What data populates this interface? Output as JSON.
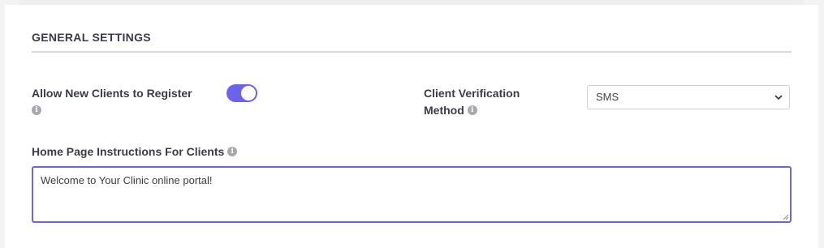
{
  "section": {
    "title": "GENERAL SETTINGS"
  },
  "allow_register": {
    "label": "Allow New Clients to Register",
    "enabled": true
  },
  "verification": {
    "label_line1": "Client Verification",
    "label_line2": "Method",
    "selected": "SMS"
  },
  "instructions": {
    "label": "Home Page Instructions For Clients",
    "value": "Welcome to Your Clinic online portal!"
  },
  "icons": {
    "info": "info-circle-icon",
    "chevron": "chevron-down-icon",
    "grip": "resize-grip-icon",
    "info_glyph": "i"
  },
  "colors": {
    "accent": "#6b63ea",
    "info_icon": "#a9a9ad"
  }
}
